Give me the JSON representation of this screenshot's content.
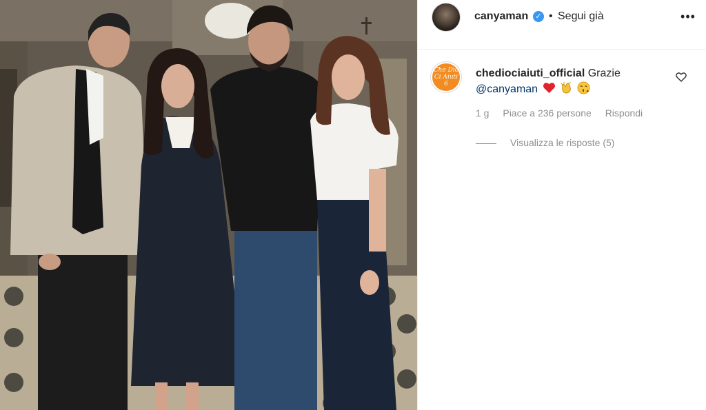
{
  "header": {
    "username": "canyaman",
    "separator": "•",
    "follow_status": "Segui già",
    "more_icon": "more-horizontal-icon"
  },
  "comment": {
    "avatar_text": "Che Dio Ci Aiuti 6",
    "username": "chediociaiuti_official",
    "text": "Grazie",
    "mention": "@canyaman",
    "emojis": [
      "red-heart",
      "clapping-hands",
      "face-blowing-kiss"
    ],
    "time": "1 g",
    "likes": "Piace a 236 persone",
    "reply_label": "Rispondi",
    "view_replies": "Visualizza le risposte (5)",
    "like_icon": "heart-outline-icon"
  },
  "colors": {
    "text": "#262626",
    "muted": "#8e8e8e",
    "verified": "#3897f0",
    "mention": "#00376b",
    "avatar_brand": "#f28b21"
  }
}
